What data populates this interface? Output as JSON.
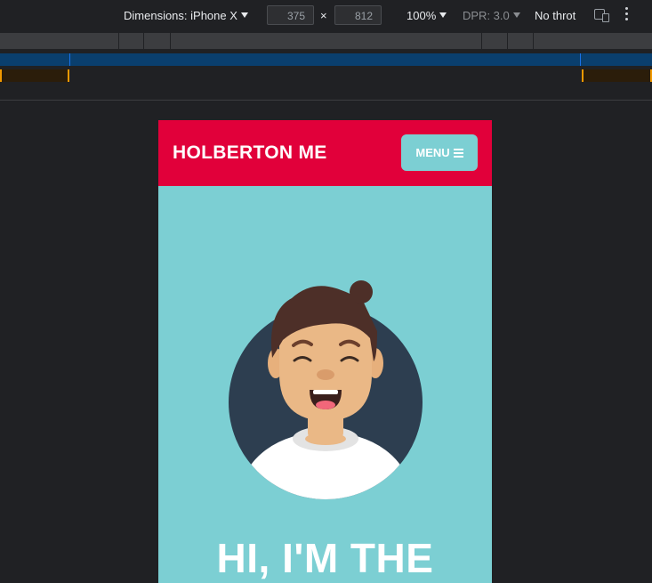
{
  "devtools": {
    "dimensions_label": "Dimensions: iPhone X",
    "width_value": "375",
    "height_value": "812",
    "times_sign": "×",
    "zoom": "100%",
    "dpr": "DPR: 3.0",
    "throttle": "No throt"
  },
  "site": {
    "brand": "HOLBERTON ME",
    "menu_label": "MENU",
    "hero_title": "HI, I'M THE"
  },
  "colors": {
    "header_red": "#e1003a",
    "teal": "#7ccfd3",
    "avatar_circle": "#2d3e50"
  }
}
